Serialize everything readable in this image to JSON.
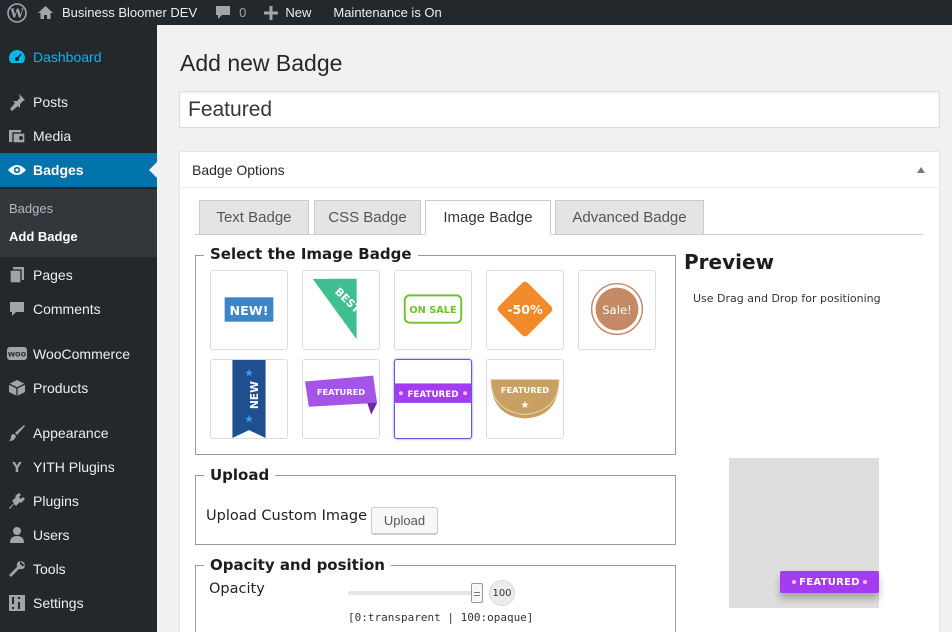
{
  "admin_bar": {
    "site_name": "Business Bloomer DEV",
    "comments_count": "0",
    "new_label": "New",
    "maintenance": "Maintenance is On"
  },
  "sidebar": {
    "items": [
      {
        "label": "Dashboard",
        "icon": "dashboard-icon"
      },
      {
        "label": "Posts",
        "icon": "pushpin-icon"
      },
      {
        "label": "Media",
        "icon": "media-icon"
      },
      {
        "label": "Badges",
        "icon": "eye-icon"
      },
      {
        "label": "Pages",
        "icon": "pages-icon"
      },
      {
        "label": "Comments",
        "icon": "comment-icon"
      },
      {
        "label": "WooCommerce",
        "icon": "woo-icon"
      },
      {
        "label": "Products",
        "icon": "box-icon"
      },
      {
        "label": "Appearance",
        "icon": "brush-icon"
      },
      {
        "label": "YITH Plugins",
        "icon": "yith-icon"
      },
      {
        "label": "Plugins",
        "icon": "plug-icon"
      },
      {
        "label": "Users",
        "icon": "user-icon"
      },
      {
        "label": "Tools",
        "icon": "wrench-icon"
      },
      {
        "label": "Settings",
        "icon": "settings-icon"
      }
    ],
    "submenu": [
      {
        "label": "Badges"
      },
      {
        "label": "Add Badge"
      }
    ]
  },
  "page": {
    "title": "Add new Badge",
    "post_title": "Featured"
  },
  "badge_options": {
    "header": "Badge Options",
    "tabs": [
      "Text Badge",
      "CSS Badge",
      "Image Badge",
      "Advanced Badge"
    ],
    "active_tab": "Image Badge",
    "select_legend": "Select the Image Badge",
    "badges": [
      {
        "text": "NEW!"
      },
      {
        "text": "BEST"
      },
      {
        "text": "ON SALE"
      },
      {
        "text": "-50%"
      },
      {
        "text": "Sale!"
      },
      {
        "text": "NEW"
      },
      {
        "text": "FEATURED"
      },
      {
        "text": "FEATURED"
      },
      {
        "text": "FEATURED"
      }
    ],
    "selected_badge_index": 7,
    "upload_legend": "Upload",
    "upload_label": "Upload Custom Image",
    "upload_button": "Upload",
    "opacity_legend": "Opacity and position",
    "opacity_label": "Opacity",
    "opacity_value": "100",
    "opacity_hint": "[0:transparent | 100:opaque]"
  },
  "preview": {
    "title": "Preview",
    "hint": "Use Drag and Drop for positioning",
    "badge_text": "FEATURED"
  },
  "colors": {
    "admin_bg": "#23282d",
    "accent": "#0073aa",
    "featured_purple": "#a43cf2"
  }
}
